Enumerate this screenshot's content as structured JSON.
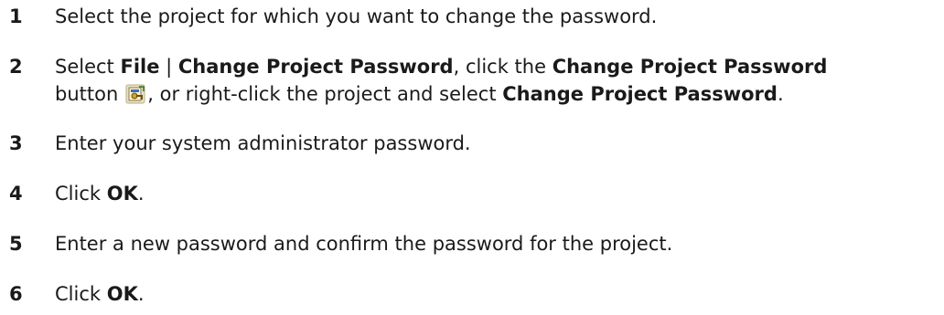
{
  "steps": [
    {
      "number": "1",
      "text": "Select the project for which you want to change the password."
    },
    {
      "number": "2",
      "select_prefix": "Select ",
      "menu_file": "File",
      "menu_separator": " | ",
      "menu_item": "Change Project Password",
      "click_text": ", click the ",
      "button_name": "Change Project Password",
      "button_word": "button",
      "after_icon": ", or right-click the project and select ",
      "context_item": "Change Project Password",
      "period": ".",
      "icon": "change-password-icon"
    },
    {
      "number": "3",
      "text": "Enter your system administrator password."
    },
    {
      "number": "4",
      "prefix": "Click ",
      "bold": "OK",
      "suffix": "."
    },
    {
      "number": "5",
      "text": "Enter a new password and confirm the password for the project."
    },
    {
      "number": "6",
      "prefix": "Click ",
      "bold": "OK",
      "suffix": "."
    }
  ]
}
